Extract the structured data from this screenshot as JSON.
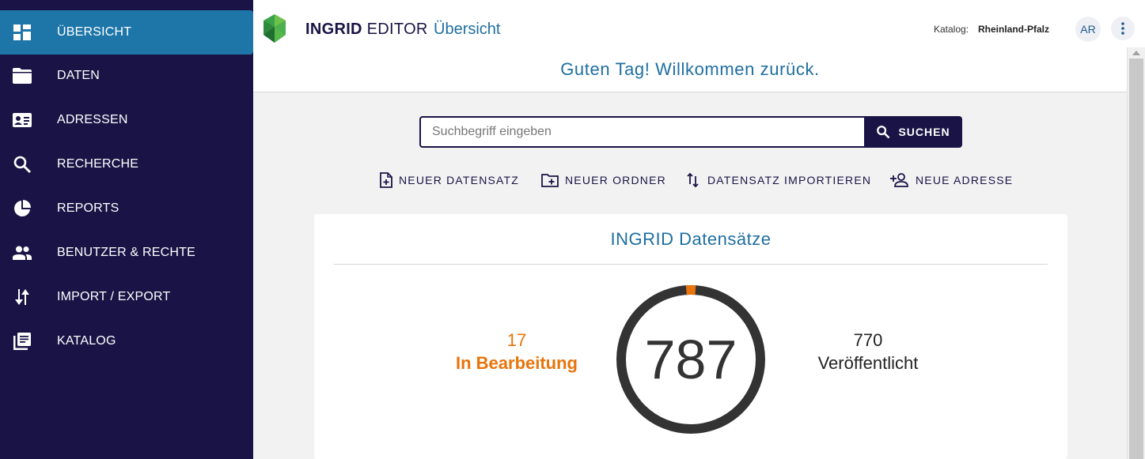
{
  "sidebar": {
    "items": [
      {
        "label": "ÜBERSICHT",
        "icon": "dashboard-icon",
        "active": true
      },
      {
        "label": "DATEN",
        "icon": "folder-icon"
      },
      {
        "label": "ADRESSEN",
        "icon": "contact-card-icon"
      },
      {
        "label": "RECHERCHE",
        "icon": "search-icon"
      },
      {
        "label": "REPORTS",
        "icon": "pie-chart-icon"
      },
      {
        "label": "BENUTZER & RECHTE",
        "icon": "people-icon"
      },
      {
        "label": "IMPORT / EXPORT",
        "icon": "import-export-icon"
      },
      {
        "label": "KATALOG",
        "icon": "library-books-icon"
      }
    ],
    "bg_color": "#1a1446",
    "active_color": "#1e76a8"
  },
  "header": {
    "brand_bold": "INGRID",
    "brand_rest": " EDITOR",
    "page_title": "Übersicht",
    "katalog_label": "Katalog:",
    "katalog_value": "Rheinland-Pfalz",
    "avatar_initials": "AR"
  },
  "welcome": {
    "text": "Guten Tag! Willkommen zurück."
  },
  "search": {
    "placeholder": "Suchbegriff eingeben",
    "value": "",
    "button_label": "SUCHEN"
  },
  "actions": [
    {
      "label": "NEUER DATENSATZ",
      "icon": "note-add-icon"
    },
    {
      "label": "NEUER ORDNER",
      "icon": "create-folder-icon"
    },
    {
      "label": "DATENSATZ IMPORTIEREN",
      "icon": "import-arrows-icon"
    },
    {
      "label": "NEUE ADRESSE",
      "icon": "person-add-icon"
    }
  ],
  "stats_card": {
    "title": "INGRID Datensätze",
    "total": "787",
    "in_progress_count": "17",
    "in_progress_label": "In Bearbeitung",
    "published_count": "770",
    "published_label": "Veröffentlicht",
    "in_progress_color": "#e8740c",
    "published_color": "#333333"
  }
}
